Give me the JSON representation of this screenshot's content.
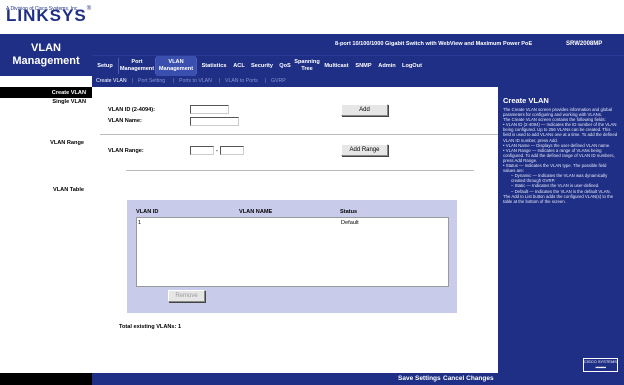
{
  "brand": {
    "name": "LINKSYS",
    "reg": "®",
    "tagline": "A Division of Cisco Systems, Inc."
  },
  "section": {
    "line1": "VLAN",
    "line2": "Management"
  },
  "product": {
    "title": "8-port 10/100/1000 Gigabit Switch with WebView and Maximum Power PoE",
    "model": "SRW2008MP"
  },
  "tabs": [
    {
      "label": "Setup"
    },
    {
      "label": "Port Management"
    },
    {
      "label": "VLAN Management"
    },
    {
      "label": "Statistics"
    },
    {
      "label": "ACL"
    },
    {
      "label": "Security"
    },
    {
      "label": "QoS"
    },
    {
      "label": "Spanning Tree"
    },
    {
      "label": "Multicast"
    },
    {
      "label": "SNMP"
    },
    {
      "label": "Admin"
    },
    {
      "label": "LogOut"
    }
  ],
  "subtabs": [
    {
      "label": "Create VLAN"
    },
    {
      "label": "Port Setting"
    },
    {
      "label": "Ports to VLAN"
    },
    {
      "label": "VLAN to Ports"
    },
    {
      "label": "GVRP"
    }
  ],
  "subtab_sep": "|",
  "left_labels": {
    "create_vlan": "Create VLAN",
    "single_vlan": "Single VLAN",
    "vlan_range": "VLAN Range",
    "vlan_table": "VLAN Table"
  },
  "form": {
    "vlan_id_label": "VLAN ID (2-4094):",
    "vlan_name_label": "VLAN Name:",
    "vlan_id_value": "",
    "vlan_name_value": "",
    "add_button": "Add",
    "range_label": "VLAN Range:",
    "range_from": "",
    "range_to": "",
    "range_dash": "-",
    "add_range_button": "Add Range"
  },
  "table": {
    "headers": [
      "VLAN ID",
      "VLAN NAME",
      "Status"
    ],
    "rows": [
      {
        "id": "1",
        "name": "",
        "status": "Default"
      }
    ],
    "remove_button": "Remove"
  },
  "total_text": "Total existing VLANs: 1",
  "help": {
    "title": "Create VLAN",
    "paragraphs": [
      "The Create VLAN screen provides information and global parameters for configuring and working with VLANs.",
      "The Create VLAN screen contains the following fields:",
      "• VLAN ID (2-4094) — Indicates the ID number of the VLAN being configured. Up to 256 VLANs can be created. This field is used to add VLANs one at a time. To add the defined VLAN ID number, press Add.",
      "• VLAN Name — Displays the user-defined VLAN name.",
      "• VLAN Range — Indicates a range of VLANs being configured. To add the defined range of VLAN ID numbers, press Add Range.",
      "• Status — Indicates the VLAN type. The possible field values are:",
      "– Dynamic — Indicates the VLAN was dynamically created through GVRP.",
      "– Static — Indicates the VLAN is user-defined.",
      "– Default — Indicates the VLAN is the default VLAN.",
      "The Add to List button adds the configured VLAN(s) to the table at the bottom of the screen."
    ]
  },
  "cisco_logo": {
    "text": "CISCO SYSTEMS",
    "icon": "cisco-bars-icon"
  },
  "footer": {
    "save": "Save Settings",
    "cancel": "Cancel Changes"
  },
  "colors": {
    "brand_blue": "#1f2f86",
    "active_tab": "#3b4fae",
    "table_bg": "#c9cbea"
  }
}
